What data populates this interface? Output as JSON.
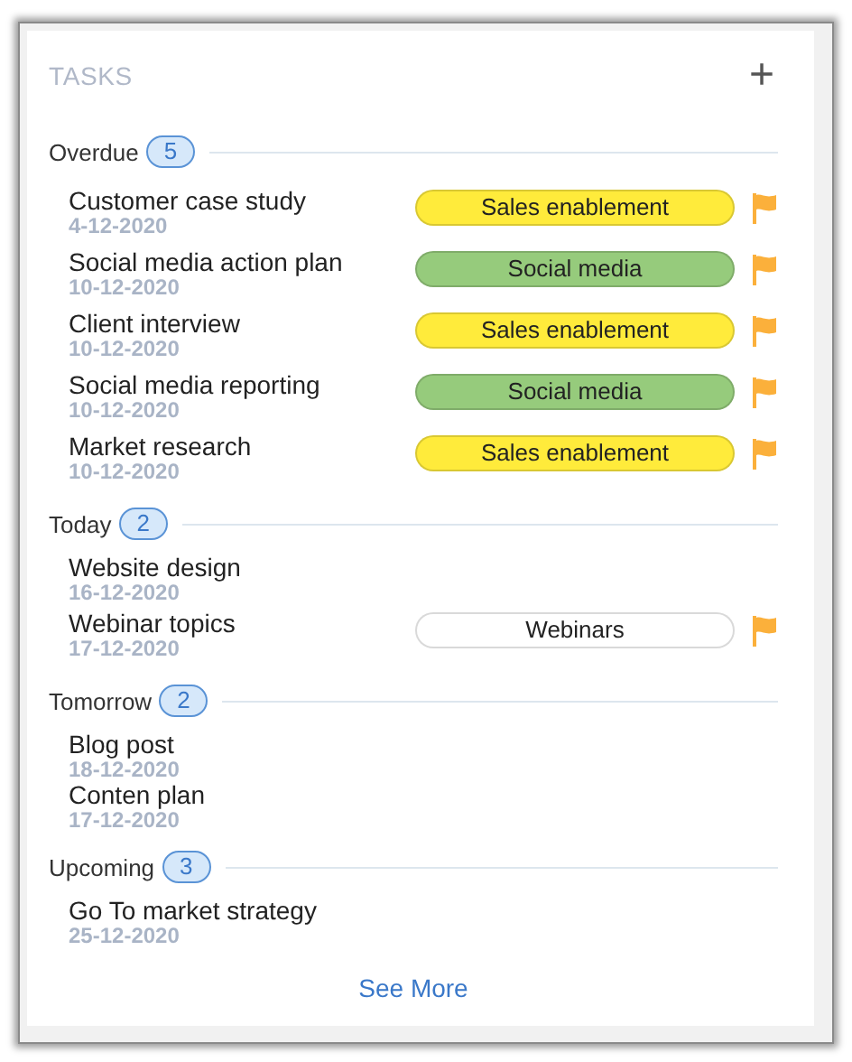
{
  "title": "TASKS",
  "add_button": "+",
  "groups": [
    {
      "label": "Overdue",
      "count": "5",
      "tasks": [
        {
          "title": "Customer case study",
          "date": "4-12-2020",
          "tag": "Sales enablement",
          "color": "#ffeb3b",
          "flagged": true
        },
        {
          "title": "Social media action plan",
          "date": "10-12-2020",
          "tag": "Social media",
          "color": "#96cb7c",
          "flagged": true
        },
        {
          "title": "Client interview",
          "date": "10-12-2020",
          "tag": "Sales enablement",
          "color": "#ffeb3b",
          "flagged": true
        },
        {
          "title": "Social media reporting",
          "date": "10-12-2020",
          "tag": "Social media",
          "color": "#96cb7c",
          "flagged": true
        },
        {
          "title": "Market research",
          "date": "10-12-2020",
          "tag": "Sales enablement",
          "color": "#ffeb3b",
          "flagged": true
        }
      ]
    },
    {
      "label": "Today",
      "count": "2",
      "tasks": [
        {
          "title": "Website design",
          "date": "16-12-2020",
          "flagged": false
        },
        {
          "title": "Webinar topics",
          "date": "17-12-2020",
          "tag": "Webinars",
          "color": "#ffffff",
          "flagged": true
        }
      ]
    },
    {
      "label": "Tomorrow",
      "count": "2",
      "tasks": [
        {
          "title": "Blog post",
          "date": "18-12-2020",
          "flagged": false
        },
        {
          "title": "Conten plan",
          "date": "17-12-2020",
          "flagged": false
        }
      ]
    },
    {
      "label": "Upcoming",
      "count": "3",
      "tasks": [
        {
          "title": "Go To market strategy",
          "date": "25-12-2020",
          "flagged": false
        }
      ]
    }
  ],
  "see_more": "See More"
}
